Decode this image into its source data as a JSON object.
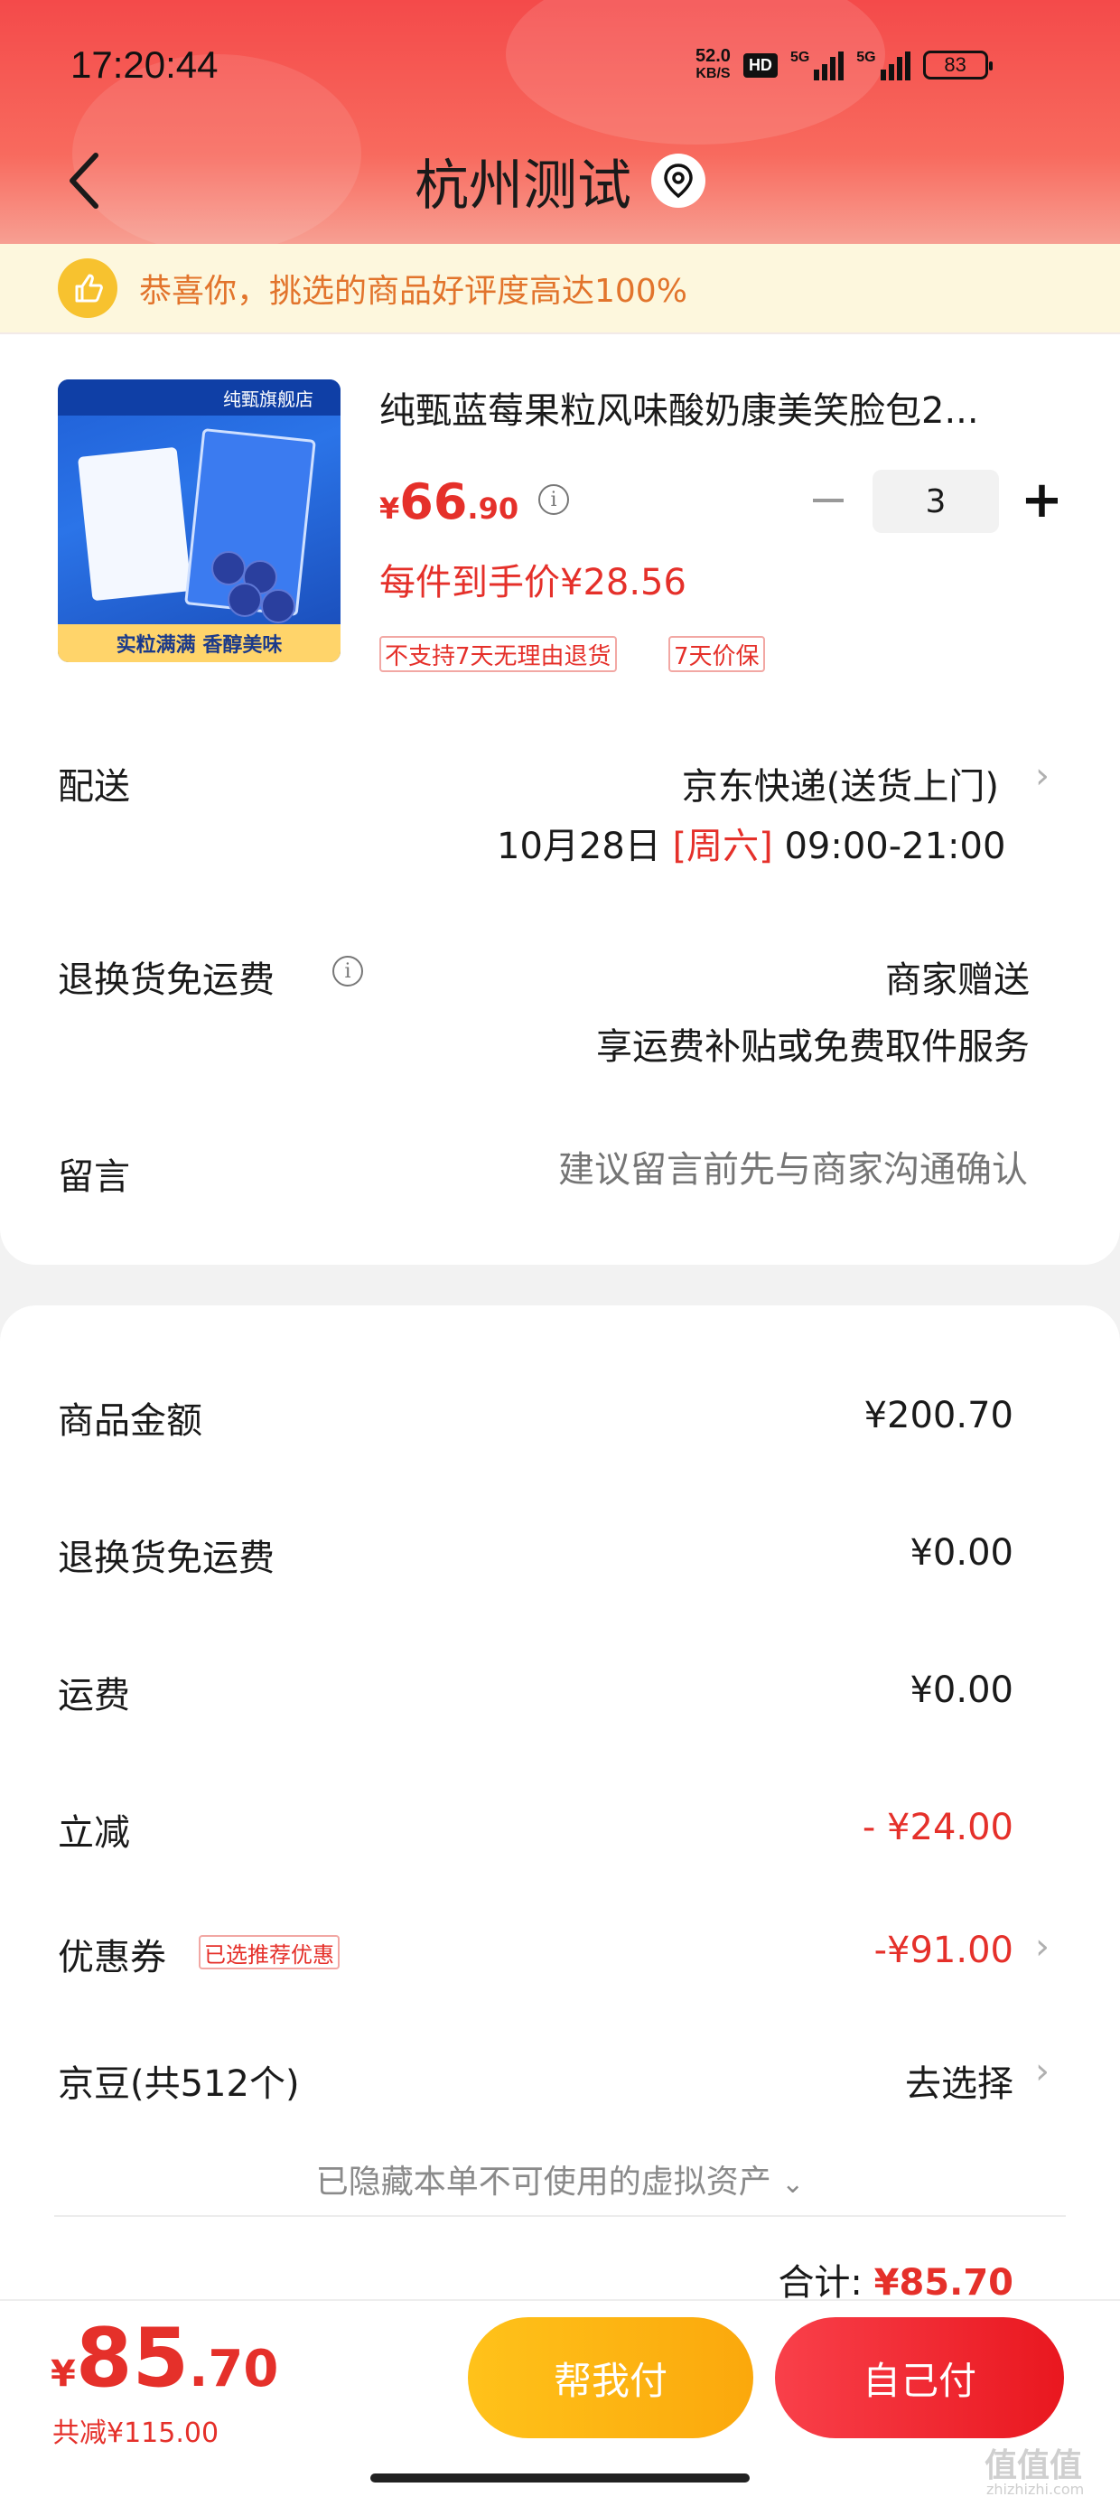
{
  "status_bar": {
    "time": "17:20:44",
    "net_speed_value": "52.0",
    "net_speed_unit": "KB/S",
    "hd": "HD",
    "sig1": "5G",
    "sig2": "5G",
    "battery": "83"
  },
  "header": {
    "title": "杭州测试",
    "back_icon": "chevron-left-icon",
    "location_icon": "location-pin-icon"
  },
  "banner": {
    "text": "恭喜你，挑选的商品好评度高达100%"
  },
  "product": {
    "name": "纯甄蓝莓果粒风味酸奶康美笑脸包2...",
    "image_brand": "纯甄旗舰店",
    "image_slogan": "实粒满满 香醇美味",
    "price_currency": "¥",
    "price_int": "66",
    "price_dec": ".90",
    "quantity": "3",
    "unit_price_text": "每件到手价¥28.56",
    "tags": [
      "不支持7天无理由退货",
      "7天价保"
    ]
  },
  "delivery": {
    "label": "配送",
    "method": "京东快递(送货上门)",
    "date": "10月28日",
    "weekday": "[周六]",
    "time": "09:00-21:00"
  },
  "return_shipping": {
    "label": "退换货免运费",
    "value": "商家赠送",
    "sub": "享运费补贴或免费取件服务"
  },
  "message": {
    "label": "留言",
    "placeholder": "建议留言前先与商家沟通确认"
  },
  "summary": {
    "goods_amount_label": "商品金额",
    "goods_amount": "¥200.70",
    "return_fee_label": "退换货免运费",
    "return_fee": "¥0.00",
    "shipping_label": "运费",
    "shipping": "¥0.00",
    "discount_label": "立减",
    "discount": "- ¥24.00",
    "coupon_label": "优惠券",
    "coupon_tag": "已选推荐优惠",
    "coupon": "-¥91.00",
    "beans_label": "京豆(共512个)",
    "beans_action": "去选择",
    "hidden_assets": "已隐藏本单不可使用的虚拟资产",
    "total_label": "合计:",
    "total": "¥85.70"
  },
  "footer": {
    "pay_currency": "¥",
    "pay_int": "85",
    "pay_dec": ".70",
    "saved": "共减¥115.00",
    "help_pay": "帮我付",
    "self_pay": "自己付"
  },
  "watermark": {
    "text": "值值值",
    "sub": "zhizhizhi.com"
  },
  "colors": {
    "accent_red": "#e5302a",
    "help_button": "#fba80c",
    "self_button": "#e9171f",
    "banner_text": "#e2742c"
  }
}
